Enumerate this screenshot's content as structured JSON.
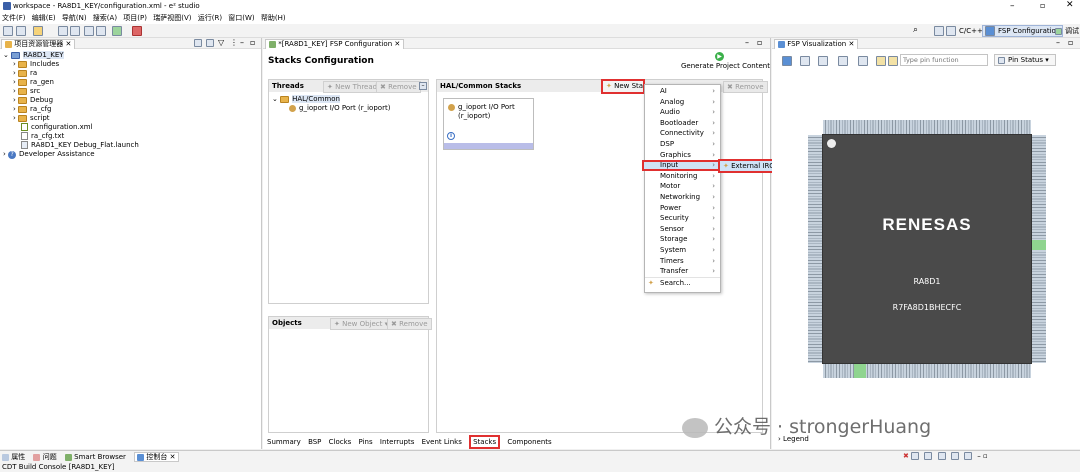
{
  "window": {
    "title": "workspace - RA8D1_KEY/configuration.xml - e² studio"
  },
  "menubar": [
    "文件(F)",
    "编辑(E)",
    "导航(N)",
    "搜索(A)",
    "项目(P)",
    "瑞萨视图(V)",
    "运行(R)",
    "窗口(W)",
    "帮助(H)"
  ],
  "perspectives": {
    "cpp": "C/C++",
    "fsp": "FSP Configuration",
    "debug": "调试"
  },
  "explorer": {
    "tab": "项目资源管理器",
    "items": [
      {
        "label": "RA8D1_KEY",
        "kind": "project",
        "indent": 0
      },
      {
        "label": "Includes",
        "kind": "folder",
        "indent": 1
      },
      {
        "label": "ra",
        "kind": "folder",
        "indent": 1
      },
      {
        "label": "ra_gen",
        "kind": "folder",
        "indent": 1
      },
      {
        "label": "src",
        "kind": "folder",
        "indent": 1
      },
      {
        "label": "Debug",
        "kind": "folder",
        "indent": 1
      },
      {
        "label": "ra_cfg",
        "kind": "folder",
        "indent": 1
      },
      {
        "label": "script",
        "kind": "folder",
        "indent": 1
      },
      {
        "label": "configuration.xml",
        "kind": "file",
        "indent": 1
      },
      {
        "label": "ra_cfg.txt",
        "kind": "file",
        "indent": 1
      },
      {
        "label": "RA8D1_KEY Debug_Flat.launch",
        "kind": "file",
        "indent": 1
      },
      {
        "label": "Developer Assistance",
        "kind": "help",
        "indent": 0
      }
    ]
  },
  "editor": {
    "tab": "*[RA8D1_KEY] FSP Configuration",
    "title": "Stacks Configuration",
    "generate": "Generate Project Content",
    "threads": {
      "label": "Threads",
      "new_thread": "New Thread",
      "remove": "Remove",
      "hal": "HAL/Common",
      "ioport": "g_ioport I/O Port (r_ioport)"
    },
    "objects": {
      "label": "Objects",
      "new_object": "New Object",
      "remove": "Remove"
    },
    "stacks": {
      "label": "HAL/Common Stacks",
      "new_stack": "New Stack",
      "remove": "Remove",
      "card_line1": "g_ioport I/O Port",
      "card_line2": "(r_ioport)",
      "info": "i"
    },
    "bottom_tabs": [
      "Summary",
      "BSP",
      "Clocks",
      "Pins",
      "Interrupts",
      "Event Links",
      "Stacks",
      "Components"
    ]
  },
  "stack_menu": {
    "items": [
      "AI",
      "Analog",
      "Audio",
      "Bootloader",
      "Connectivity",
      "DSP",
      "Graphics",
      "Input",
      "Monitoring",
      "Motor",
      "Networking",
      "Power",
      "Security",
      "Sensor",
      "Storage",
      "System",
      "Timers",
      "Transfer",
      "Search..."
    ],
    "submenu": "External IRQ (r_icu)"
  },
  "fsp_viz": {
    "tab": "FSP Visualization",
    "filter_placeholder": "Type pin function",
    "pin_status": "Pin Status",
    "brand": "RENESAS",
    "chip": "RA8D1",
    "part": "R7FA8D1BHECFC",
    "legend": "Legend"
  },
  "watermark": "公众号 · strongerHuang",
  "bottom": {
    "tabs": [
      "属性",
      "问题",
      "Smart Browser",
      "控制台"
    ],
    "console": "CDT Build Console [RA8D1_KEY]"
  }
}
